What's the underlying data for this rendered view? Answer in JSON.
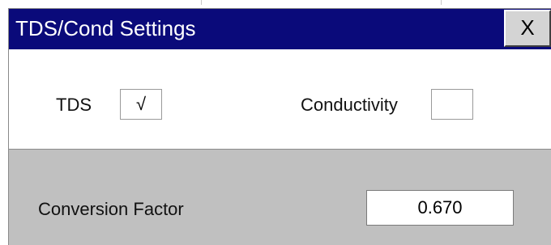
{
  "dialog": {
    "title": "TDS/Cond Settings",
    "close_label": "X"
  },
  "options": {
    "tds_label": "TDS",
    "tds_check_mark": "√",
    "tds_checked": true,
    "conductivity_label": "Conductivity",
    "conductivity_check_mark": "",
    "conductivity_checked": false
  },
  "conversion": {
    "label": "Conversion Factor",
    "value": "0.670"
  },
  "colors": {
    "title_bar": "#0a0a7a",
    "panel_gray": "#c0c0c0"
  }
}
